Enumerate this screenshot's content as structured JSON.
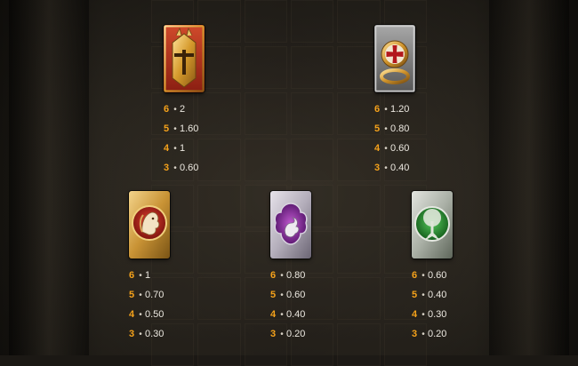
{
  "paytable": {
    "symbols": [
      {
        "name": "Knight Helmet",
        "icon": "knight-helmet-icon",
        "accent": "#c8892a",
        "pays": [
          {
            "count": "6",
            "value": "2"
          },
          {
            "count": "5",
            "value": "1.60"
          },
          {
            "count": "4",
            "value": "1"
          },
          {
            "count": "3",
            "value": "0.60"
          }
        ]
      },
      {
        "name": "Templar Ring",
        "icon": "templar-ring-icon",
        "accent": "#8a8a8a",
        "pays": [
          {
            "count": "6",
            "value": "1.20"
          },
          {
            "count": "5",
            "value": "0.80"
          },
          {
            "count": "4",
            "value": "0.60"
          },
          {
            "count": "3",
            "value": "0.40"
          }
        ]
      },
      {
        "name": "Lion Crest",
        "icon": "lion-crest-icon",
        "accent": "#c0392b",
        "pays": [
          {
            "count": "6",
            "value": "1"
          },
          {
            "count": "5",
            "value": "0.70"
          },
          {
            "count": "4",
            "value": "0.50"
          },
          {
            "count": "3",
            "value": "0.30"
          }
        ]
      },
      {
        "name": "Dragon Emblem",
        "icon": "dragon-emblem-icon",
        "accent": "#9b3fb0",
        "pays": [
          {
            "count": "6",
            "value": "0.80"
          },
          {
            "count": "5",
            "value": "0.60"
          },
          {
            "count": "4",
            "value": "0.40"
          },
          {
            "count": "3",
            "value": "0.20"
          }
        ]
      },
      {
        "name": "Tree of Life",
        "icon": "tree-of-life-icon",
        "accent": "#2e9b3a",
        "pays": [
          {
            "count": "6",
            "value": "0.60"
          },
          {
            "count": "5",
            "value": "0.40"
          },
          {
            "count": "4",
            "value": "0.30"
          },
          {
            "count": "3",
            "value": "0.20"
          }
        ]
      }
    ],
    "separator": "•"
  }
}
